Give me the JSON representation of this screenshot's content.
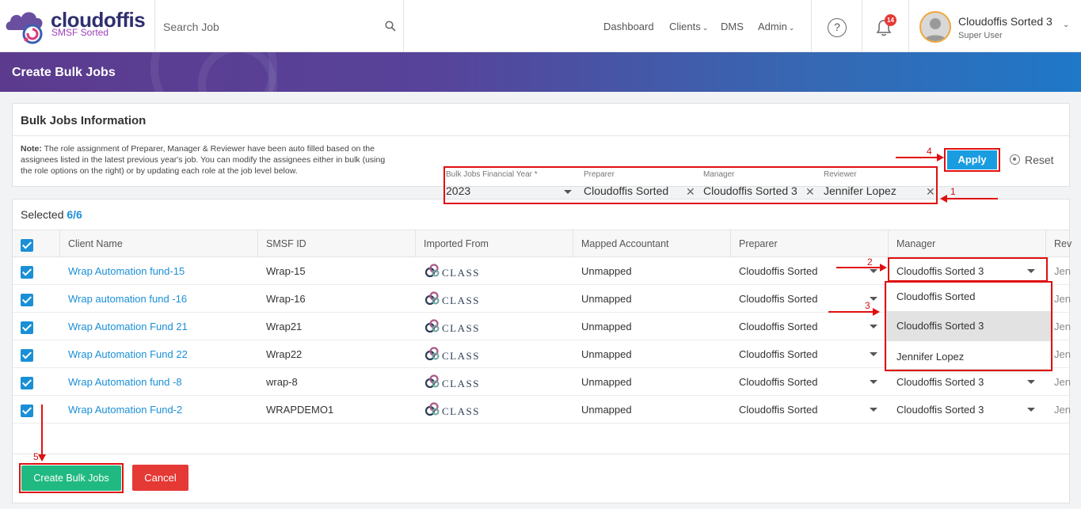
{
  "header": {
    "logo_name": "cloudoffis",
    "logo_sub": "SMSF Sorted",
    "search_placeholder": "Search Job",
    "nav": [
      "Dashboard",
      "Clients",
      "DMS",
      "Admin"
    ],
    "notification_count": "14",
    "help_label": "?",
    "user_name": "Cloudoffis Sorted 3",
    "user_role": "Super User"
  },
  "banner": {
    "title": "Create Bulk Jobs"
  },
  "info_panel": {
    "title": "Bulk Jobs Information",
    "note_label": "Note:",
    "note_text": "The role assignment of Preparer, Manager & Reviewer have been auto filled based on the assignees listed in the latest previous year's job. You can modify the assignees either in bulk (using the role options on the right) or by updating each role at the job level below.",
    "fields": {
      "year_label": "Bulk Jobs Financial Year *",
      "year_value": "2023",
      "preparer_label": "Preparer",
      "preparer_value": "Cloudoffis Sorted",
      "manager_label": "Manager",
      "manager_value": "Cloudoffis Sorted 3",
      "reviewer_label": "Reviewer",
      "reviewer_value": "Jennifer Lopez"
    },
    "apply_label": "Apply",
    "reset_label": "Reset"
  },
  "annotations": {
    "s1": "1",
    "s2": "2",
    "s3": "3",
    "s4": "4",
    "s5": "5"
  },
  "table": {
    "selected_label": "Selected",
    "selected_count": "6/6",
    "headers": [
      "Client Name",
      "SMSF ID",
      "Imported From",
      "Mapped Accountant",
      "Preparer",
      "Manager",
      "Rev"
    ],
    "rows": [
      {
        "client": "Wrap Automation fund-15",
        "smsf_id": "Wrap-15",
        "imported_from": "CLASS",
        "accountant": "Unmapped",
        "preparer": "Cloudoffis Sorted",
        "manager": "Cloudoffis Sorted 3",
        "reviewer": "Jen"
      },
      {
        "client": "Wrap automation fund -16",
        "smsf_id": "Wrap-16",
        "imported_from": "CLASS",
        "accountant": "Unmapped",
        "preparer": "Cloudoffis Sorted",
        "manager": "",
        "reviewer": "Jen"
      },
      {
        "client": "Wrap Automation Fund 21",
        "smsf_id": "Wrap21",
        "imported_from": "CLASS",
        "accountant": "Unmapped",
        "preparer": "Cloudoffis Sorted",
        "manager": "",
        "reviewer": "Jen"
      },
      {
        "client": "Wrap Automation Fund 22",
        "smsf_id": "Wrap22",
        "imported_from": "CLASS",
        "accountant": "Unmapped",
        "preparer": "Cloudoffis Sorted",
        "manager": "",
        "reviewer": "Jen"
      },
      {
        "client": "Wrap Automation fund -8",
        "smsf_id": "wrap-8",
        "imported_from": "CLASS",
        "accountant": "Unmapped",
        "preparer": "Cloudoffis Sorted",
        "manager": "Cloudoffis Sorted 3",
        "reviewer": "Jen"
      },
      {
        "client": "Wrap Automation Fund-2",
        "smsf_id": "WRAPDEMO1",
        "imported_from": "CLASS",
        "accountant": "Unmapped",
        "preparer": "Cloudoffis Sorted",
        "manager": "Cloudoffis Sorted 3",
        "reviewer": "Jen"
      }
    ]
  },
  "manager_dropdown": {
    "options": [
      "Cloudoffis Sorted",
      "Cloudoffis Sorted 3",
      "Jennifer Lopez"
    ],
    "highlighted": "Cloudoffis Sorted 3"
  },
  "footer": {
    "create_label": "Create Bulk Jobs",
    "cancel_label": "Cancel"
  },
  "colors": {
    "accent": "#1a8fd6",
    "apply": "#1a9de0",
    "create": "#20b982",
    "cancel": "#e53935",
    "annotation": "#e01010"
  }
}
